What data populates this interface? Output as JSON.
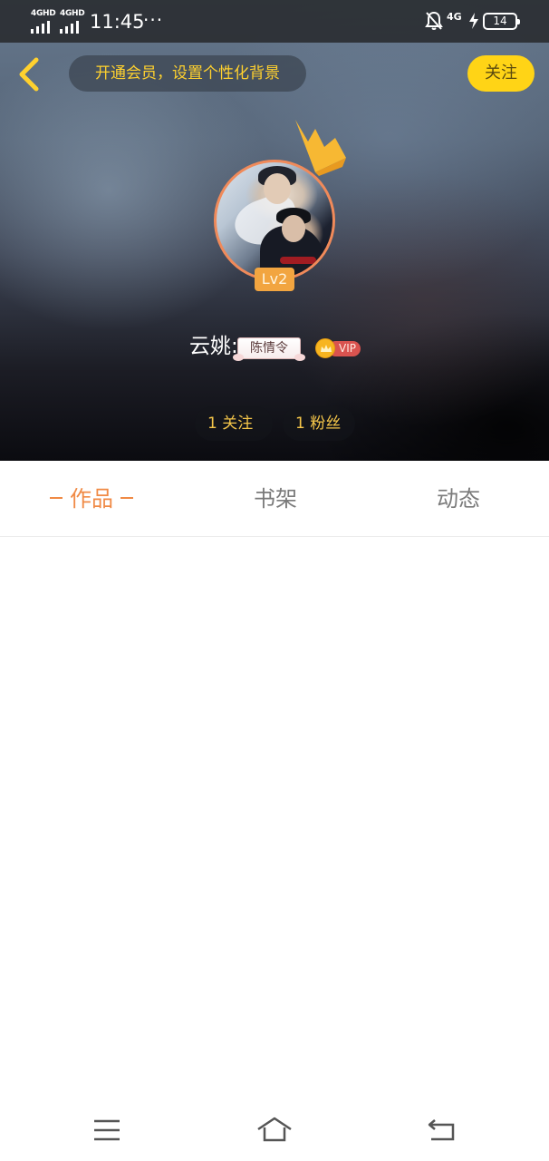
{
  "status_bar": {
    "sim1": "4GHD",
    "sim2": "4GHD",
    "time": "11:45",
    "more": "···",
    "network": "4G",
    "battery": "14"
  },
  "header": {
    "vip_banner": "开通会员，设置个性化背景",
    "follow_label": "关注"
  },
  "profile": {
    "level": "Lv2",
    "name": "云姚",
    "name_tail": ":",
    "fandom_badge": "陈情令",
    "vip_label": "VIP",
    "following_count": "1",
    "following_label": "关注",
    "fans_count": "1",
    "fans_label": "粉丝"
  },
  "tabs": [
    {
      "label": "作品",
      "active": true
    },
    {
      "label": "书架",
      "active": false
    },
    {
      "label": "动态",
      "active": false
    }
  ],
  "colors": {
    "accent": "#f08a45",
    "follow_button": "#ffd416",
    "level_badge": "#f2a540",
    "crown": "#f7b833",
    "count_text": "#f5c64a"
  },
  "icons": [
    "back-arrow-icon",
    "crown-icon",
    "bell-off-icon",
    "charging-icon",
    "menu-icon",
    "home-icon",
    "return-icon"
  ]
}
